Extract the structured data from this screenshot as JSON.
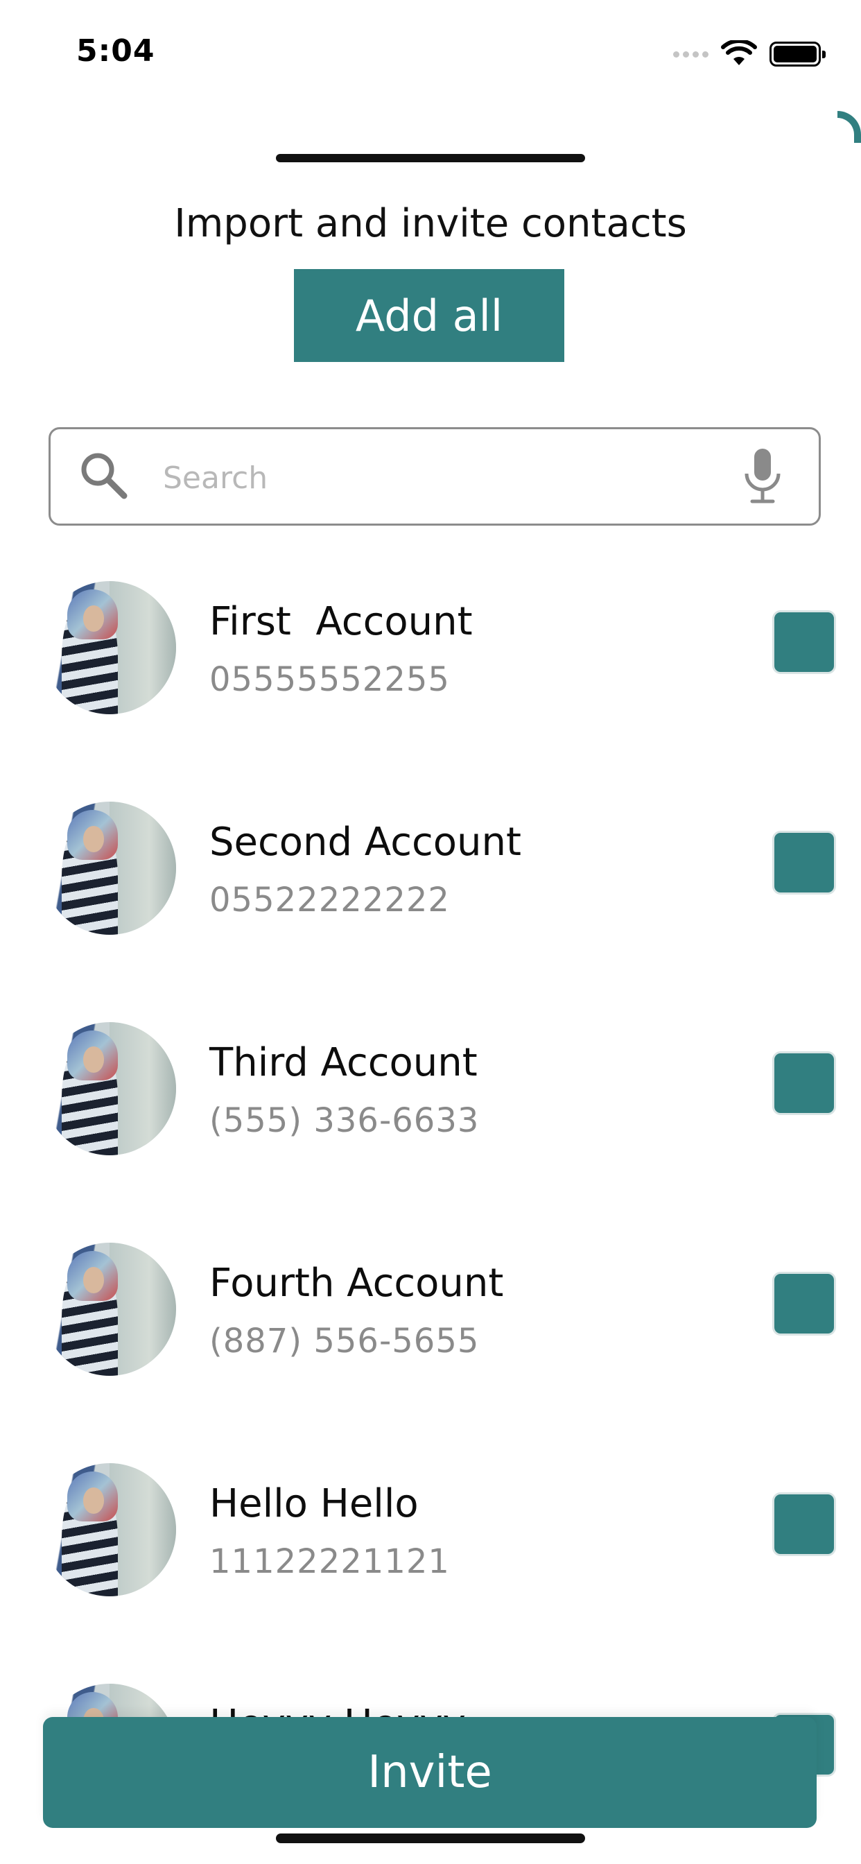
{
  "status_bar": {
    "time": "5:04"
  },
  "sheet": {
    "title": "Import and invite contacts",
    "add_all_label": "Add all"
  },
  "search": {
    "placeholder": "Search",
    "value": ""
  },
  "contacts": [
    {
      "name": "First  Account",
      "phone": "05555552255",
      "checked": true
    },
    {
      "name": "Second Account",
      "phone": "05522222222",
      "checked": true
    },
    {
      "name": "Third Account",
      "phone": "(555) 336-6633",
      "checked": true
    },
    {
      "name": "Fourth Account",
      "phone": "(887) 556-5655",
      "checked": true
    },
    {
      "name": "Hello Hello",
      "phone": "11122221121",
      "checked": true
    },
    {
      "name": "Heyyy Heyyy",
      "phone": "",
      "checked": true
    }
  ],
  "invite_label": "Invite",
  "colors": {
    "accent": "#317f80",
    "text": "#0d0d0d",
    "muted": "#8a8a8a"
  },
  "icons": [
    "search-icon",
    "microphone-icon",
    "wifi-icon",
    "battery-icon",
    "cellular-signal-icon"
  ]
}
